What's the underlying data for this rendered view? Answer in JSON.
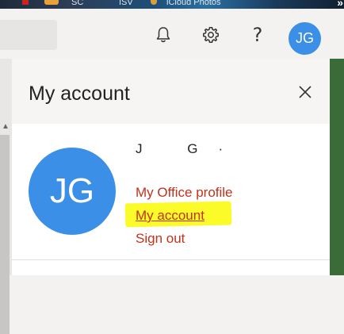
{
  "browser_strip": {
    "items": [
      "SC",
      "ISV",
      "iCloud Photos"
    ],
    "overflow": "»"
  },
  "header": {
    "icons": [
      "bell-icon",
      "gear-icon",
      "help-icon"
    ],
    "help_glyph": "?",
    "avatar_initials": "JG"
  },
  "panel": {
    "title": "My account",
    "avatar_initials": "JG",
    "user_name": "J G·",
    "links": {
      "profile": "My Office profile",
      "account": "My account",
      "signout": "Sign out"
    }
  },
  "colors": {
    "avatar": "#3b8fe6",
    "link": "#c4311b",
    "highlight": "#fbfb2a"
  }
}
